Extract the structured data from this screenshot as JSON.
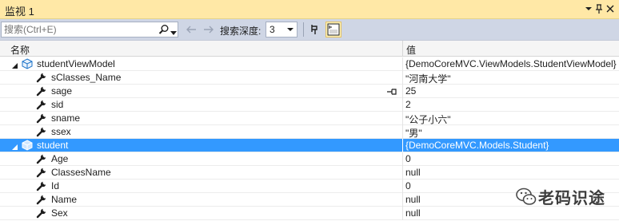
{
  "window": {
    "title": "监视 1"
  },
  "toolbar": {
    "search_placeholder": "搜索(Ctrl+E)",
    "depth_label": "搜索深度:",
    "depth_value": "3"
  },
  "columns": {
    "name": "名称",
    "value": "值"
  },
  "rows": [
    {
      "name": "studentViewModel",
      "value": "{DemoCoreMVC.ViewModels.StudentViewModel}",
      "level": 0,
      "kind": "object",
      "expanded": true
    },
    {
      "name": "sClasses_Name",
      "value": "\"河南大学\"",
      "level": 1,
      "kind": "property"
    },
    {
      "name": "sage",
      "value": "25",
      "level": 1,
      "kind": "property",
      "pin": true
    },
    {
      "name": "sid",
      "value": "2",
      "level": 1,
      "kind": "property"
    },
    {
      "name": "sname",
      "value": "\"公子小六\"",
      "level": 1,
      "kind": "property"
    },
    {
      "name": "ssex",
      "value": "\"男\"",
      "level": 1,
      "kind": "property"
    },
    {
      "name": "student",
      "value": "{DemoCoreMVC.Models.Student}",
      "level": 0,
      "kind": "object",
      "expanded": true,
      "selected": true
    },
    {
      "name": "Age",
      "value": "0",
      "level": 1,
      "kind": "property"
    },
    {
      "name": "ClassesName",
      "value": "null",
      "level": 1,
      "kind": "property"
    },
    {
      "name": "Id",
      "value": "0",
      "level": 1,
      "kind": "property"
    },
    {
      "name": "Name",
      "value": "null",
      "level": 1,
      "kind": "property"
    },
    {
      "name": "Sex",
      "value": "null",
      "level": 1,
      "kind": "property"
    }
  ],
  "watermark": {
    "text": "老码识途"
  },
  "icons": {
    "object": "cube-icon",
    "property": "wrench-icon",
    "pin": "pin-icon"
  },
  "colors": {
    "title_bar": "#ffe8a6",
    "toolbar": "#cfd6e5",
    "selection": "#3399ff"
  }
}
